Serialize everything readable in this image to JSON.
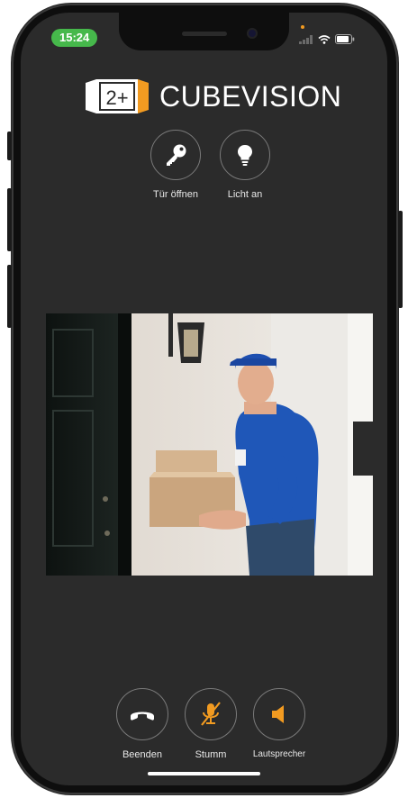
{
  "status_bar": {
    "time": "15:24"
  },
  "brand": {
    "badge": "2+",
    "name": "CUBEVISION"
  },
  "top_controls": [
    {
      "label": "Tür öffnen",
      "icon": "key-icon"
    },
    {
      "label": "Licht an",
      "icon": "lightbulb-icon"
    }
  ],
  "video": {
    "description": "doorbell-camera-feed"
  },
  "call_controls": [
    {
      "label": "Beenden",
      "icon": "hang-up-icon"
    },
    {
      "label": "Stumm",
      "icon": "mic-muted-icon"
    },
    {
      "label": "Lautsprecher",
      "icon": "speaker-icon"
    }
  ],
  "colors": {
    "accent": "#f29b21",
    "background": "#2b2b2b",
    "status_green": "#46b84b"
  }
}
